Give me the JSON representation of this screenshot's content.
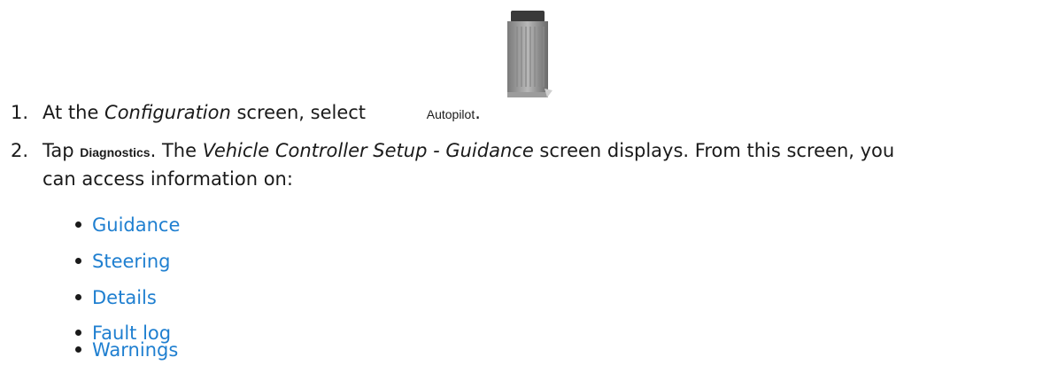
{
  "step1": {
    "number": "1.",
    "text_before": "At the ",
    "emphasis": "Configuration",
    "text_after": " screen, select",
    "icon_label": "Autopilot",
    "end": "."
  },
  "step2": {
    "number": "2.",
    "tap": "Tap ",
    "button_label": "Diagnostics",
    "text_mid": ". The ",
    "screen_name": "Vehicle Controller Setup - Guidance",
    "text_after_line1": " screen displays. From this screen, you",
    "text_line2": "can access information on:"
  },
  "links": [
    "Guidance",
    "Steering",
    "Details",
    "Fault log",
    "Warnings"
  ],
  "colors": {
    "link": "#1f7fd0",
    "text": "#1a1a1a"
  },
  "icons": {
    "autopilot": "autopilot-device-icon"
  }
}
